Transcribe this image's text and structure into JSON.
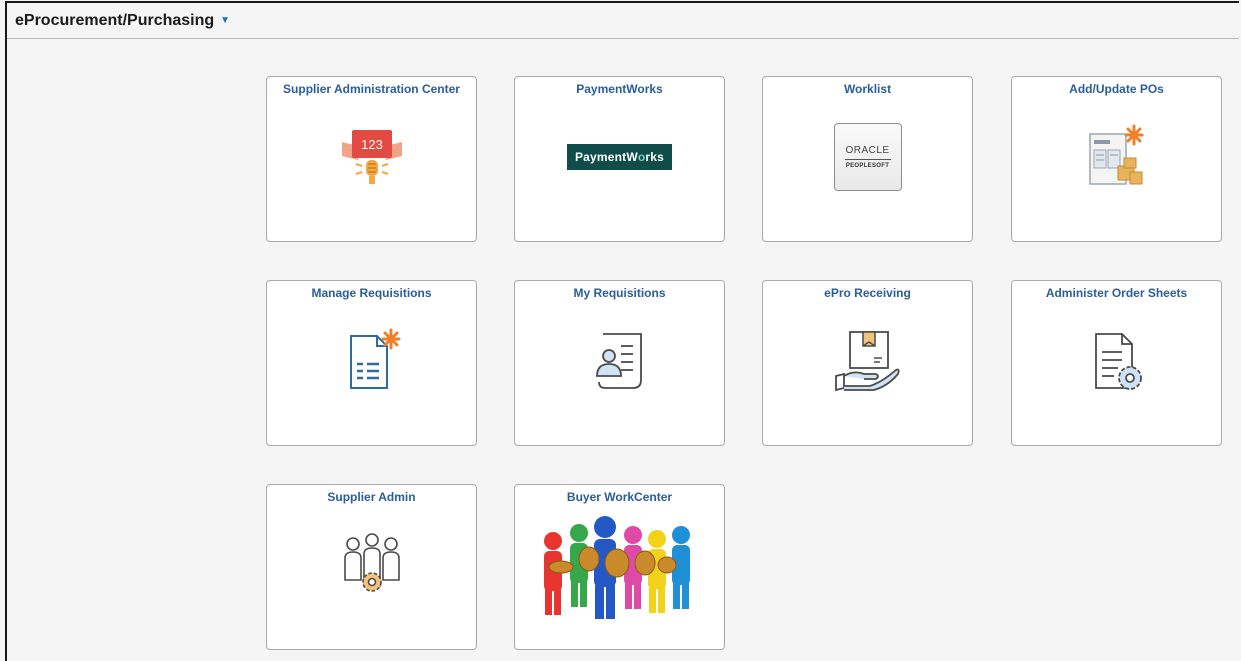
{
  "header": {
    "title": "eProcurement/Purchasing"
  },
  "tiles": {
    "supplier_admin_center": {
      "title": "Supplier Administration Center",
      "badge": "123"
    },
    "paymentworks": {
      "title": "PaymentWorks",
      "logo_text_a": "PaymentW",
      "logo_text_o": "o",
      "logo_text_b": "rks"
    },
    "worklist": {
      "title": "Worklist",
      "logo_top": "ORACLE",
      "logo_bottom": "PEOPLESOFT"
    },
    "add_update_pos": {
      "title": "Add/Update POs"
    },
    "manage_requisitions": {
      "title": "Manage Requisitions"
    },
    "my_requisitions": {
      "title": "My Requisitions"
    },
    "epro_receiving": {
      "title": "ePro Receiving"
    },
    "administer_order_sheets": {
      "title": "Administer Order Sheets"
    },
    "supplier_admin": {
      "title": "Supplier Admin"
    },
    "buyer_workcenter": {
      "title": "Buyer WorkCenter"
    }
  },
  "colors": {
    "tile_title": "#2a5d9a",
    "accent_orange": "#f07f27",
    "icon_blue": "#2f6aa1"
  }
}
